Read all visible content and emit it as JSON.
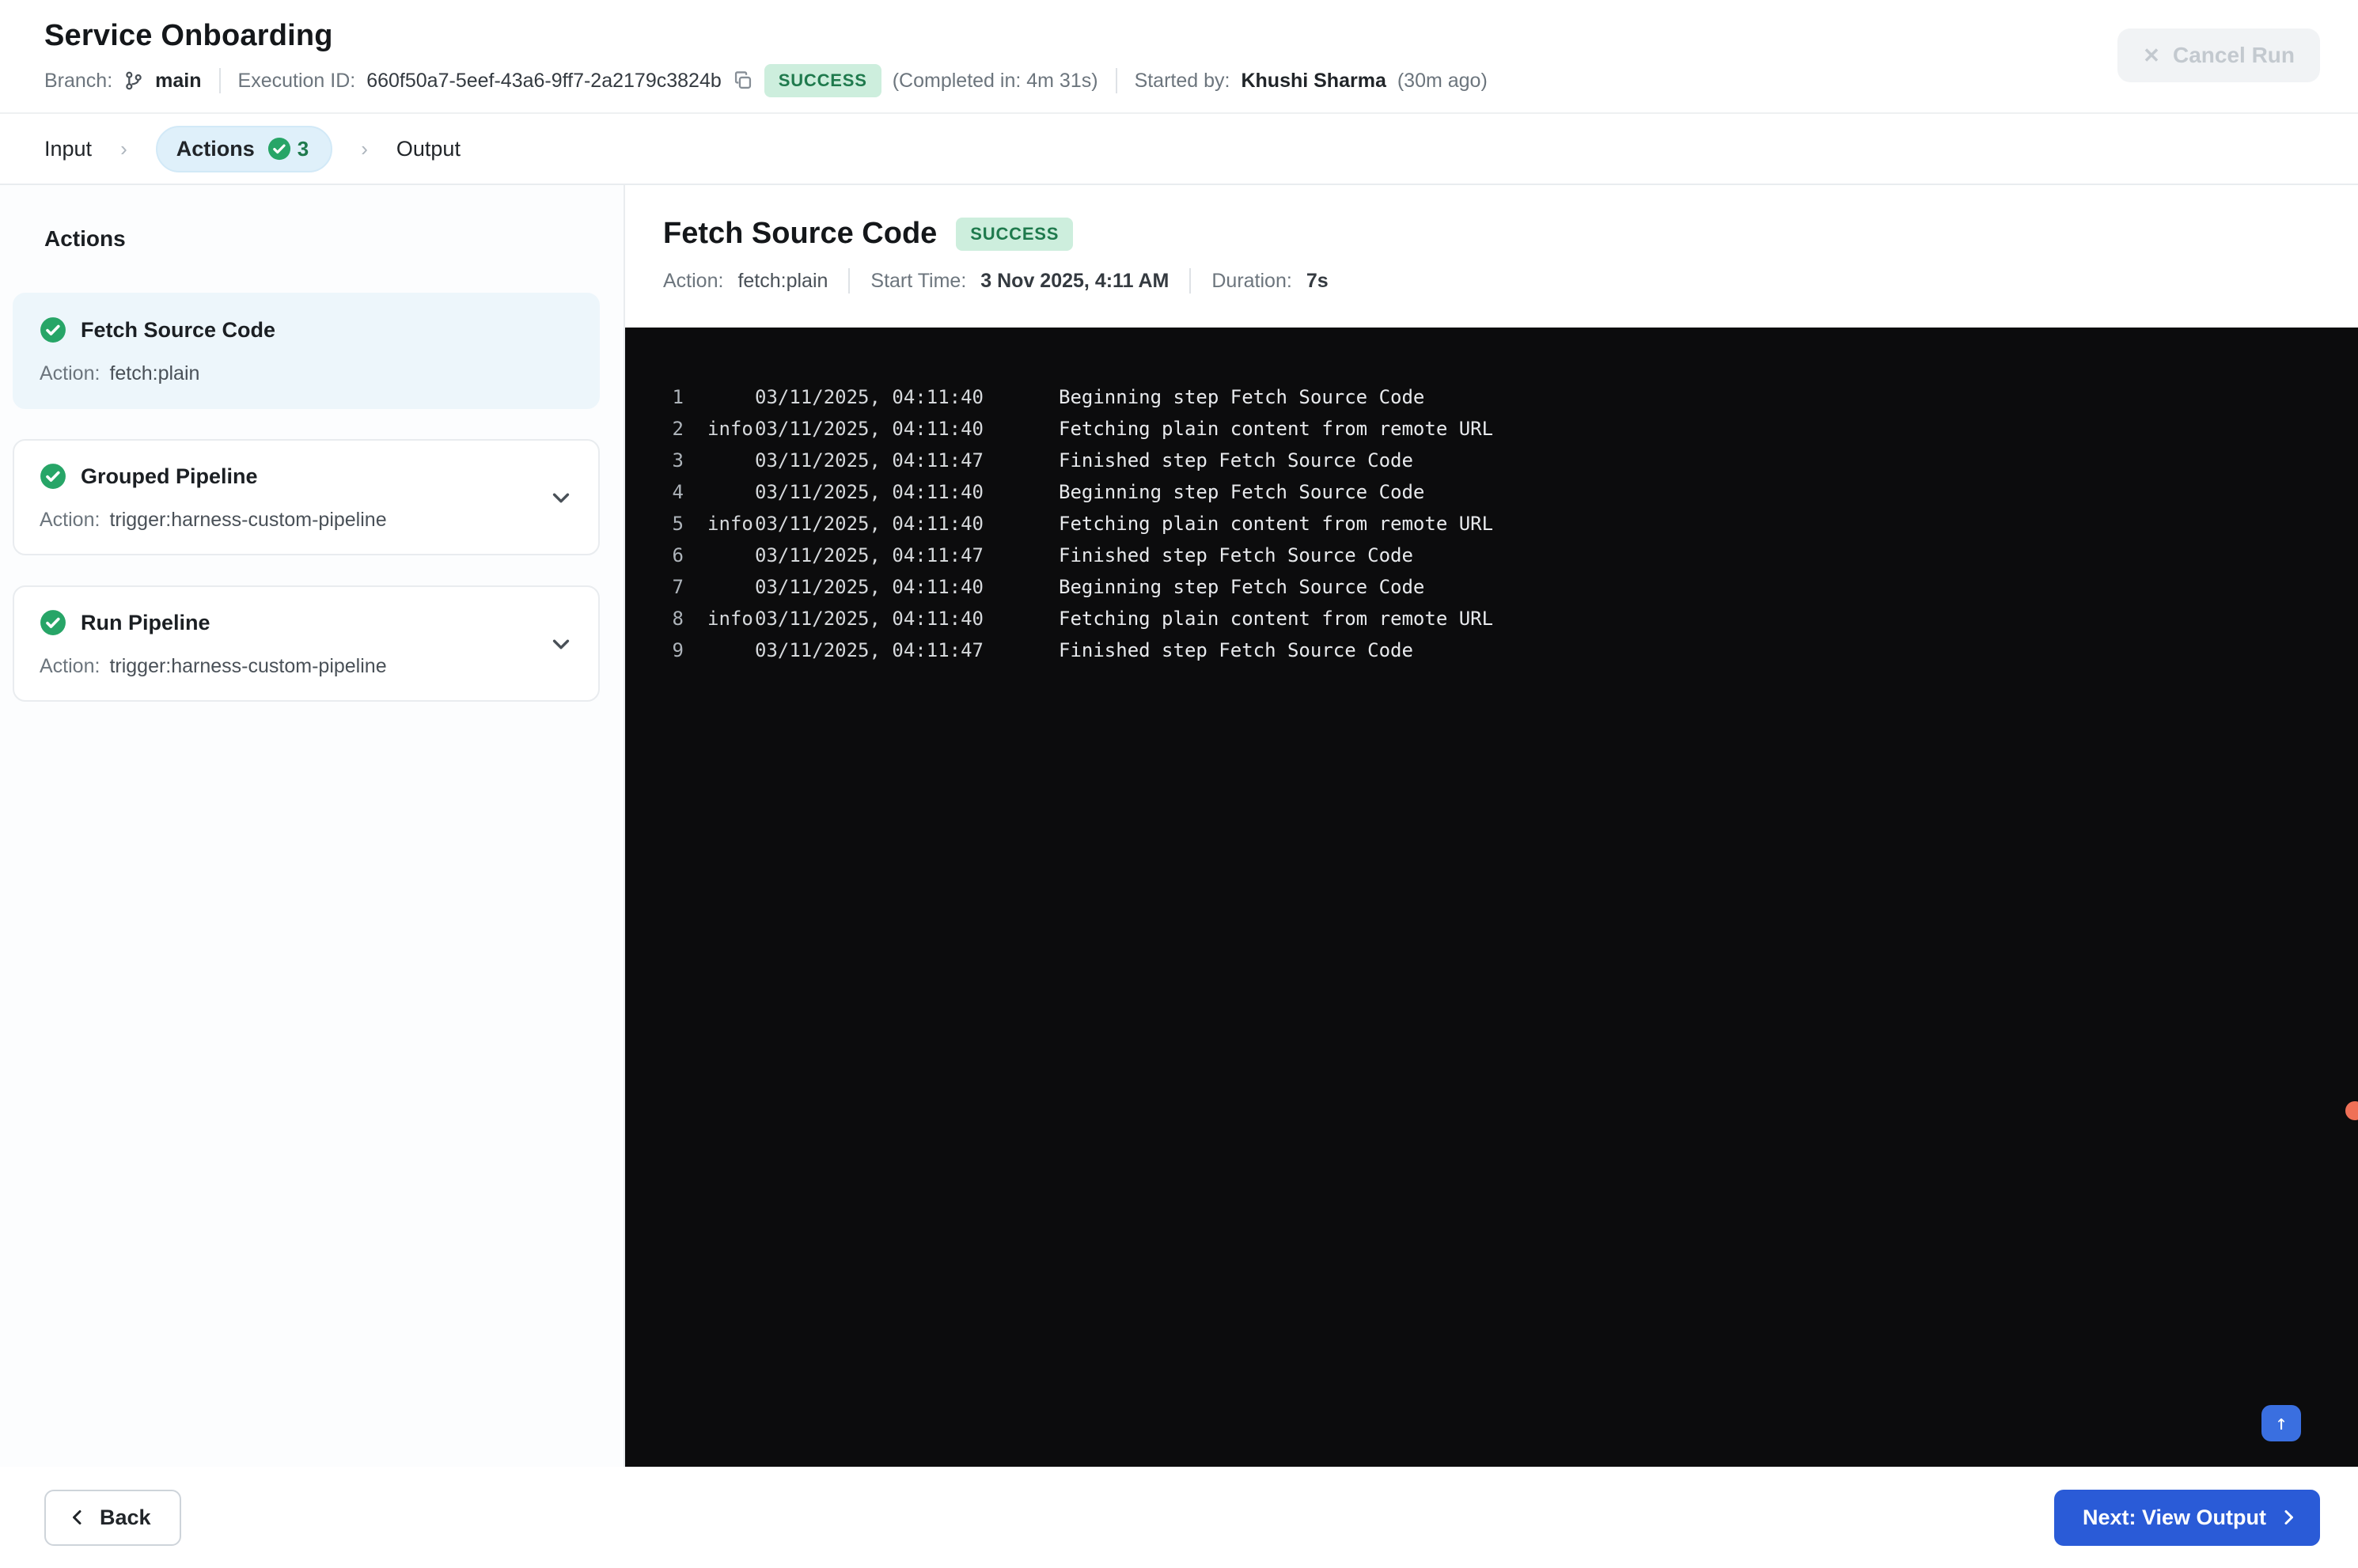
{
  "header": {
    "title": "Service Onboarding",
    "branch_label": "Branch:",
    "branch_name": "main",
    "execution_id_label": "Execution ID:",
    "execution_id": "660f50a7-5eef-43a6-9ff7-2a2179c3824b",
    "status_badge": "SUCCESS",
    "completed_in": "(Completed in: 4m 31s)",
    "started_by_label": "Started by:",
    "started_by_name": "Khushi Sharma",
    "started_ago": "(30m ago)",
    "cancel_run_label": "Cancel Run"
  },
  "stepper": {
    "steps": [
      {
        "label": "Input",
        "active": false
      },
      {
        "label": "Actions",
        "active": true,
        "badge_count": "3"
      },
      {
        "label": "Output",
        "active": false
      }
    ]
  },
  "sidebar": {
    "heading": "Actions",
    "action_label": "Action:",
    "items": [
      {
        "title": "Fetch Source Code",
        "action": "fetch:plain",
        "selected": true,
        "expandable": false,
        "status": "success"
      },
      {
        "title": "Grouped Pipeline",
        "action": "trigger:harness-custom-pipeline",
        "selected": false,
        "expandable": true,
        "status": "success"
      },
      {
        "title": "Run Pipeline",
        "action": "trigger:harness-custom-pipeline",
        "selected": false,
        "expandable": true,
        "status": "success"
      }
    ]
  },
  "detail": {
    "title": "Fetch Source Code",
    "status_badge": "SUCCESS",
    "meta": {
      "action_label": "Action:",
      "action_value": "fetch:plain",
      "start_time_label": "Start Time:",
      "start_time_value": "3 Nov 2025, 4:11 AM",
      "duration_label": "Duration:",
      "duration_value": "7s"
    },
    "log_lines": [
      {
        "num": "1",
        "level": "",
        "timestamp": "03/11/2025, 04:11:40",
        "message": "Beginning step Fetch Source Code"
      },
      {
        "num": "2",
        "level": "info",
        "timestamp": "03/11/2025, 04:11:40",
        "message": "Fetching plain content from remote URL"
      },
      {
        "num": "3",
        "level": "",
        "timestamp": "03/11/2025, 04:11:47",
        "message": "Finished step Fetch Source Code"
      },
      {
        "num": "4",
        "level": "",
        "timestamp": "03/11/2025, 04:11:40",
        "message": "Beginning step Fetch Source Code"
      },
      {
        "num": "5",
        "level": "info",
        "timestamp": "03/11/2025, 04:11:40",
        "message": "Fetching plain content from remote URL"
      },
      {
        "num": "6",
        "level": "",
        "timestamp": "03/11/2025, 04:11:47",
        "message": "Finished step Fetch Source Code"
      },
      {
        "num": "7",
        "level": "",
        "timestamp": "03/11/2025, 04:11:40",
        "message": "Beginning step Fetch Source Code"
      },
      {
        "num": "8",
        "level": "info",
        "timestamp": "03/11/2025, 04:11:40",
        "message": "Fetching plain content from remote URL"
      },
      {
        "num": "9",
        "level": "",
        "timestamp": "03/11/2025, 04:11:47",
        "message": "Finished step Fetch Source Code"
      }
    ],
    "scroll_top_icon": "↑"
  },
  "footer": {
    "back_label": "Back",
    "next_label": "Next: View Output"
  },
  "colors": {
    "success_badge_bg": "#cdeedd",
    "success_badge_text": "#1f7a4d",
    "check_green": "#27a567",
    "active_step_bg": "#dff0fa",
    "selected_card_bg": "#edf6fb",
    "primary_blue": "#2a5bd7",
    "console_bg": "#0c0c0d",
    "notify_dot": "#ef7057"
  }
}
